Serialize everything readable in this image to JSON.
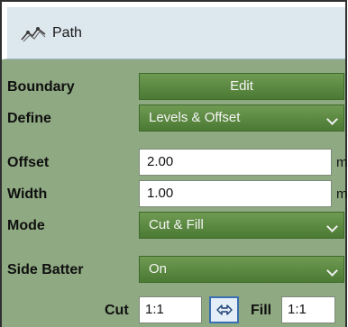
{
  "panel": {
    "title": "Path",
    "title_icon": "path-icon"
  },
  "rows": {
    "boundary": {
      "label": "Boundary",
      "button": "Edit"
    },
    "define": {
      "label": "Define",
      "value": "Levels & Offset"
    },
    "offset": {
      "label": "Offset",
      "value": "2.00",
      "unit": "m"
    },
    "width": {
      "label": "Width",
      "value": "1.00",
      "unit": "m"
    },
    "mode": {
      "label": "Mode",
      "value": "Cut & Fill"
    },
    "side_batter": {
      "label": "Side Batter",
      "value": "On"
    },
    "cut_fill": {
      "cut_label": "Cut",
      "cut_value": "1:1",
      "swap_icon": "swap-arrows-icon",
      "fill_label": "Fill",
      "fill_value": "1:1"
    }
  },
  "colors": {
    "panel_bg": "#8fa982",
    "button_green": "#5a8740",
    "title_bg": "#dde7ee"
  }
}
